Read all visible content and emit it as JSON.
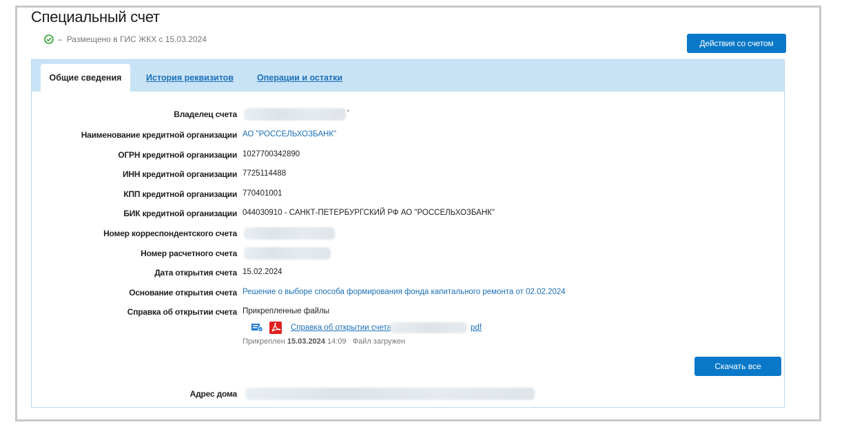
{
  "header": {
    "title": "Специальный счет",
    "status_separator": "–",
    "status_text": "Размещено в ГИС ЖКХ с 15.03.2024",
    "actions_button": "Действия со счетом"
  },
  "tabs": [
    {
      "label": "Общие сведения",
      "active": true
    },
    {
      "label": "История реквизитов",
      "active": false
    },
    {
      "label": "Операции и остатки",
      "active": false
    }
  ],
  "fields": {
    "owner": {
      "label": "Владелец счета",
      "value": "'"
    },
    "bank_name": {
      "label": "Наименование кредитной организации",
      "value": "АО \"РОССЕЛЬХОЗБАНК\""
    },
    "ogrn": {
      "label": "ОГРН кредитной организации",
      "value": "1027700342890"
    },
    "inn": {
      "label": "ИНН кредитной организации",
      "value": "7725114488"
    },
    "kpp": {
      "label": "КПП кредитной организации",
      "value": "770401001"
    },
    "bik": {
      "label": "БИК кредитной организации",
      "value": "044030910 - САНКТ-ПЕТЕРБУРГСКИЙ РФ АО \"РОССЕЛЬХОЗБАНК\""
    },
    "corr_account": {
      "label": "Номер корреспондентского счета",
      "value": ""
    },
    "account_number": {
      "label": "Номер расчетного счета",
      "value": ""
    },
    "open_date": {
      "label": "Дата открытия счета",
      "value": "15.02.2024"
    },
    "open_basis": {
      "label": "Основание открытия счета",
      "value": "Решение о выборе способа формирования фонда капитального ремонта от 02.02.2024"
    },
    "open_certificate": {
      "label": "Справка об открытии счета",
      "value": "Прикрепленные файлы"
    },
    "address": {
      "label": "Адрес дома",
      "value": ""
    }
  },
  "file": {
    "name": "Справка об открытии счета",
    "ext": "pdf",
    "attached_prefix": "Прикреплен",
    "attached_date": "15.03.2024",
    "attached_time": "14:09",
    "status": "Файл загружен"
  },
  "download_all_button": "Скачать все",
  "colors": {
    "accent": "#0a78c8",
    "tabbar": "#c9e3f6",
    "link": "#1a6fb8",
    "status_ok": "#2ca02c",
    "pdf_red": "#e02020"
  },
  "icons": [
    "check-circle-icon",
    "sign-certificate-icon",
    "pdf-icon"
  ]
}
